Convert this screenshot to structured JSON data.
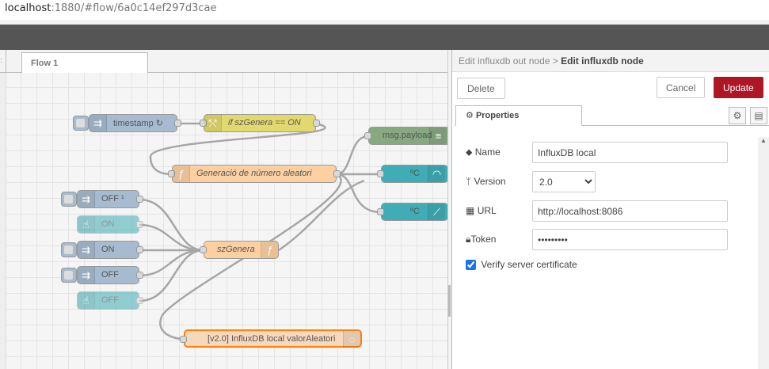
{
  "browser": {
    "url_host": "localhost",
    "url_rest": ":1880/#flow/6a0c14ef297d3cae"
  },
  "workspace": {
    "tab_label": "Flow 1",
    "nodes": {
      "timestamp": "timestamp ↻",
      "if_node": "if szGenera == ON",
      "msg_payload": "msg.payload",
      "generacio": "Generació de número aleatori",
      "gauge": "ºC",
      "chart": "ºC",
      "off1": "OFF ¹",
      "on1": "ON",
      "on2": "ON",
      "off2": "OFF",
      "off3": "OFF",
      "szgenera": "szGenera",
      "influx_out": "[v2.0] InfluxDB local valorAleatori"
    }
  },
  "panel": {
    "breadcrumb_parent": "Edit influxdb out node",
    "breadcrumb_sep": ">",
    "breadcrumb_current": "Edit influxdb node",
    "delete_label": "Delete",
    "cancel_label": "Cancel",
    "update_label": "Update",
    "properties_tab": "Properties",
    "fields": {
      "name_label": "Name",
      "name_value": "InfluxDB local",
      "version_label": "Version",
      "version_value": "2.0",
      "url_label": "URL",
      "url_value": "http://localhost:8086",
      "token_label": "Token",
      "token_value": "•••••••••",
      "verify_label": "Verify server certificate",
      "verify_checked": true
    }
  },
  "colors": {
    "update_button": "#ad1625",
    "inject": "#a6bbcf",
    "function": "#fdd0a2",
    "switch": "#e2d96e",
    "debug": "#87a980",
    "dashboard": "#3fadb5",
    "influx": "#ffa94d"
  }
}
